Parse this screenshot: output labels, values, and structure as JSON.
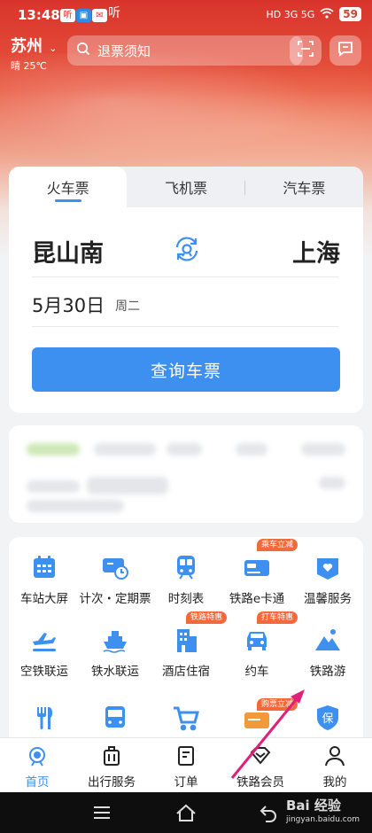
{
  "status_bar": {
    "time": "13:48",
    "app_badges": [
      "听",
      "听"
    ],
    "network": "HD 3G 5G",
    "battery": "59"
  },
  "header": {
    "city": "苏州",
    "weather": "晴 25℃",
    "search_placeholder": "退票须知"
  },
  "booking": {
    "tabs": [
      {
        "label": "火车票",
        "active": true
      },
      {
        "label": "飞机票",
        "active": false
      },
      {
        "label": "汽车票",
        "active": false
      }
    ],
    "from_station": "昆山南",
    "to_station": "上海",
    "date": "5月30日",
    "weekday": "周二",
    "query_button": "查询车票"
  },
  "services": [
    {
      "label": "车站大屏",
      "icon": "calendar-icon",
      "badge": ""
    },
    {
      "label": "计次・定期票",
      "icon": "ticket-clock-icon",
      "badge": ""
    },
    {
      "label": "时刻表",
      "icon": "train-icon",
      "badge": ""
    },
    {
      "label": "铁路e卡通",
      "icon": "card-icon",
      "badge": "乘车立减"
    },
    {
      "label": "温馨服务",
      "icon": "heart-service-icon",
      "badge": ""
    },
    {
      "label": "空铁联运",
      "icon": "plane-icon",
      "badge": ""
    },
    {
      "label": "铁水联运",
      "icon": "ship-icon",
      "badge": ""
    },
    {
      "label": "酒店住宿",
      "icon": "hotel-icon",
      "badge": "铁路特惠"
    },
    {
      "label": "约车",
      "icon": "car-icon",
      "badge": "打车特惠"
    },
    {
      "label": "铁路游",
      "icon": "mountain-icon",
      "badge": ""
    },
    {
      "label": "",
      "icon": "food-icon",
      "badge": ""
    },
    {
      "label": "",
      "icon": "bus-icon",
      "badge": ""
    },
    {
      "label": "",
      "icon": "cart-icon",
      "badge": ""
    },
    {
      "label": "",
      "icon": "ticket-card-icon",
      "badge": "购票立减"
    },
    {
      "label": "",
      "icon": "insurance-icon",
      "badge": ""
    }
  ],
  "insurance_glyph": "保",
  "bottom_nav": [
    {
      "label": "首页",
      "icon": "home-icon",
      "active": true
    },
    {
      "label": "出行服务",
      "icon": "luggage-icon",
      "active": false
    },
    {
      "label": "订单",
      "icon": "order-icon",
      "active": false
    },
    {
      "label": "铁路会员",
      "icon": "diamond-icon",
      "active": false
    },
    {
      "label": "我的",
      "icon": "user-icon",
      "active": false
    }
  ],
  "watermark": {
    "brand": "Bai 经验",
    "url": "jingyan.baidu.com"
  },
  "colors": {
    "accent": "#3d8ff0",
    "badge": "#f06a3c",
    "hero": "#d9342c"
  }
}
